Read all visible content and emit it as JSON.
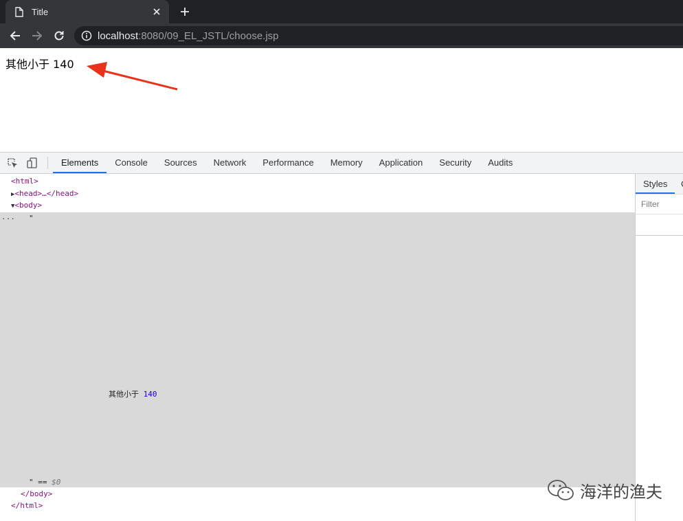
{
  "browser": {
    "tab": {
      "title": "Title"
    },
    "address": {
      "host": "localhost",
      "rest": ":8080/09_EL_JSTL/choose.jsp"
    }
  },
  "page": {
    "text": "其他小于 140"
  },
  "devtools": {
    "tabs": [
      "Elements",
      "Console",
      "Sources",
      "Network",
      "Performance",
      "Memory",
      "Application",
      "Security",
      "Audits"
    ],
    "active_tab": "Elements",
    "dom": {
      "html_open": "<html>",
      "head": "<head>…</head>",
      "body_open": "<body>",
      "ellipsis": "...",
      "quote_open": "\"",
      "text_node_label": "其他小于 ",
      "text_node_number": "140",
      "quote_close": "\" == ",
      "selection_ref": "$0",
      "body_close": "</body>",
      "html_close": "</html>"
    },
    "styles": {
      "tab_label": "Styles",
      "filter_placeholder": "Filter"
    }
  },
  "watermark": {
    "text": "海洋的渔夫"
  },
  "colors": {
    "annotation_arrow": "#e8321c",
    "active_tab_underline": "#1a73e8"
  }
}
